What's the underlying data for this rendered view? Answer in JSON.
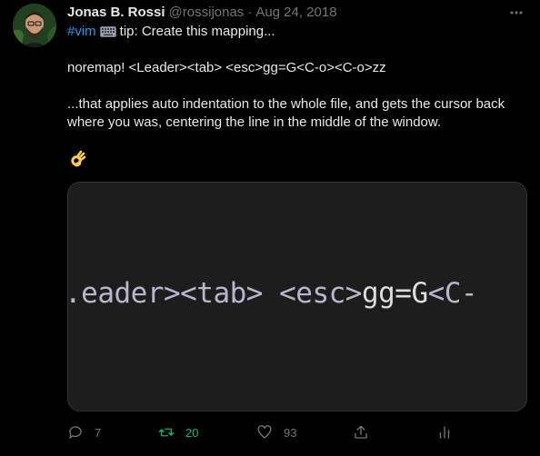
{
  "tweet": {
    "display_name": "Jonas B. Rossi",
    "handle": "@rossijonas",
    "separator": "·",
    "date": "Aug 24, 2018",
    "hashtag": "#vim",
    "line1_rest": "tip: Create this mapping...",
    "line2": "noremap! <Leader><tab> <esc>gg=G<C-o><C-o>zz",
    "line3": "...that applies auto indentation to the whole file, and gets the cursor back",
    "line4": "where you was, centering the line in the middle of the window.",
    "emoji_icon": "ok-hand-icon"
  },
  "media": {
    "code_part1": ".eader><tab> <esc>",
    "code_part2": "gg=G",
    "code_part3": "<C-",
    "background": "#1d1d1e"
  },
  "actions": {
    "replies": "7",
    "retweets": "20",
    "likes": "93"
  },
  "colors": {
    "accent": "#1d9bf0",
    "retweet": "#00ba7c",
    "muted": "#71767b"
  }
}
